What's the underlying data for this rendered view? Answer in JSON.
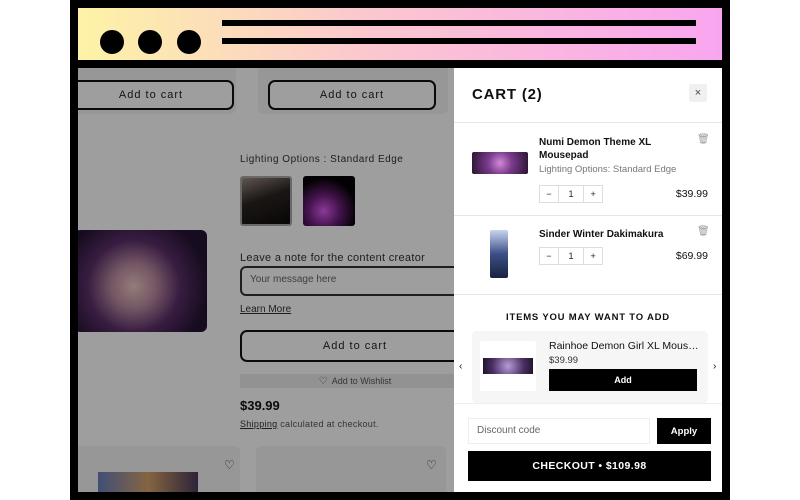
{
  "page": {
    "add_to_cart_1": "Add to cart",
    "add_to_cart_2": "Add to cart",
    "lighting_label": "Lighting Options",
    "lighting_value": "Standard Edge",
    "note_label": "Leave a note for the content creator",
    "note_placeholder": "Your message here",
    "learn_more": "Learn More",
    "add_to_cart_main": "Add to cart",
    "wishlist": "Add to Wishlist",
    "price": "$39.99",
    "shipping_link": "Shipping",
    "shipping_text": "calculated at checkout.",
    "icons": {
      "heart": "heart-icon"
    }
  },
  "cart": {
    "title": "CART (2)",
    "close": "×",
    "items": [
      {
        "name": "Numi Demon Theme XL Mousepad",
        "variant": "Lighting Options: Standard Edge",
        "qty": "1",
        "price": "$39.99",
        "minus": "−",
        "plus": "+"
      },
      {
        "name": "Sinder Winter Dakimakura",
        "variant": "",
        "qty": "1",
        "price": "$69.99",
        "minus": "−",
        "plus": "+"
      }
    ],
    "upsell": {
      "title": "ITEMS YOU MAY WANT TO ADD",
      "name": "Rainhoe Demon Girl XL Mousepad",
      "price": "$39.99",
      "add": "Add"
    },
    "discount_placeholder": "Discount code",
    "apply": "Apply",
    "checkout": "CHECKOUT • $109.98"
  },
  "colors": {
    "chrome_gradient_start": "#fdf3a6",
    "chrome_gradient_end": "#f9a6f0",
    "accent": "#000000",
    "overlay": "rgba(0,0,0,0.38)"
  }
}
